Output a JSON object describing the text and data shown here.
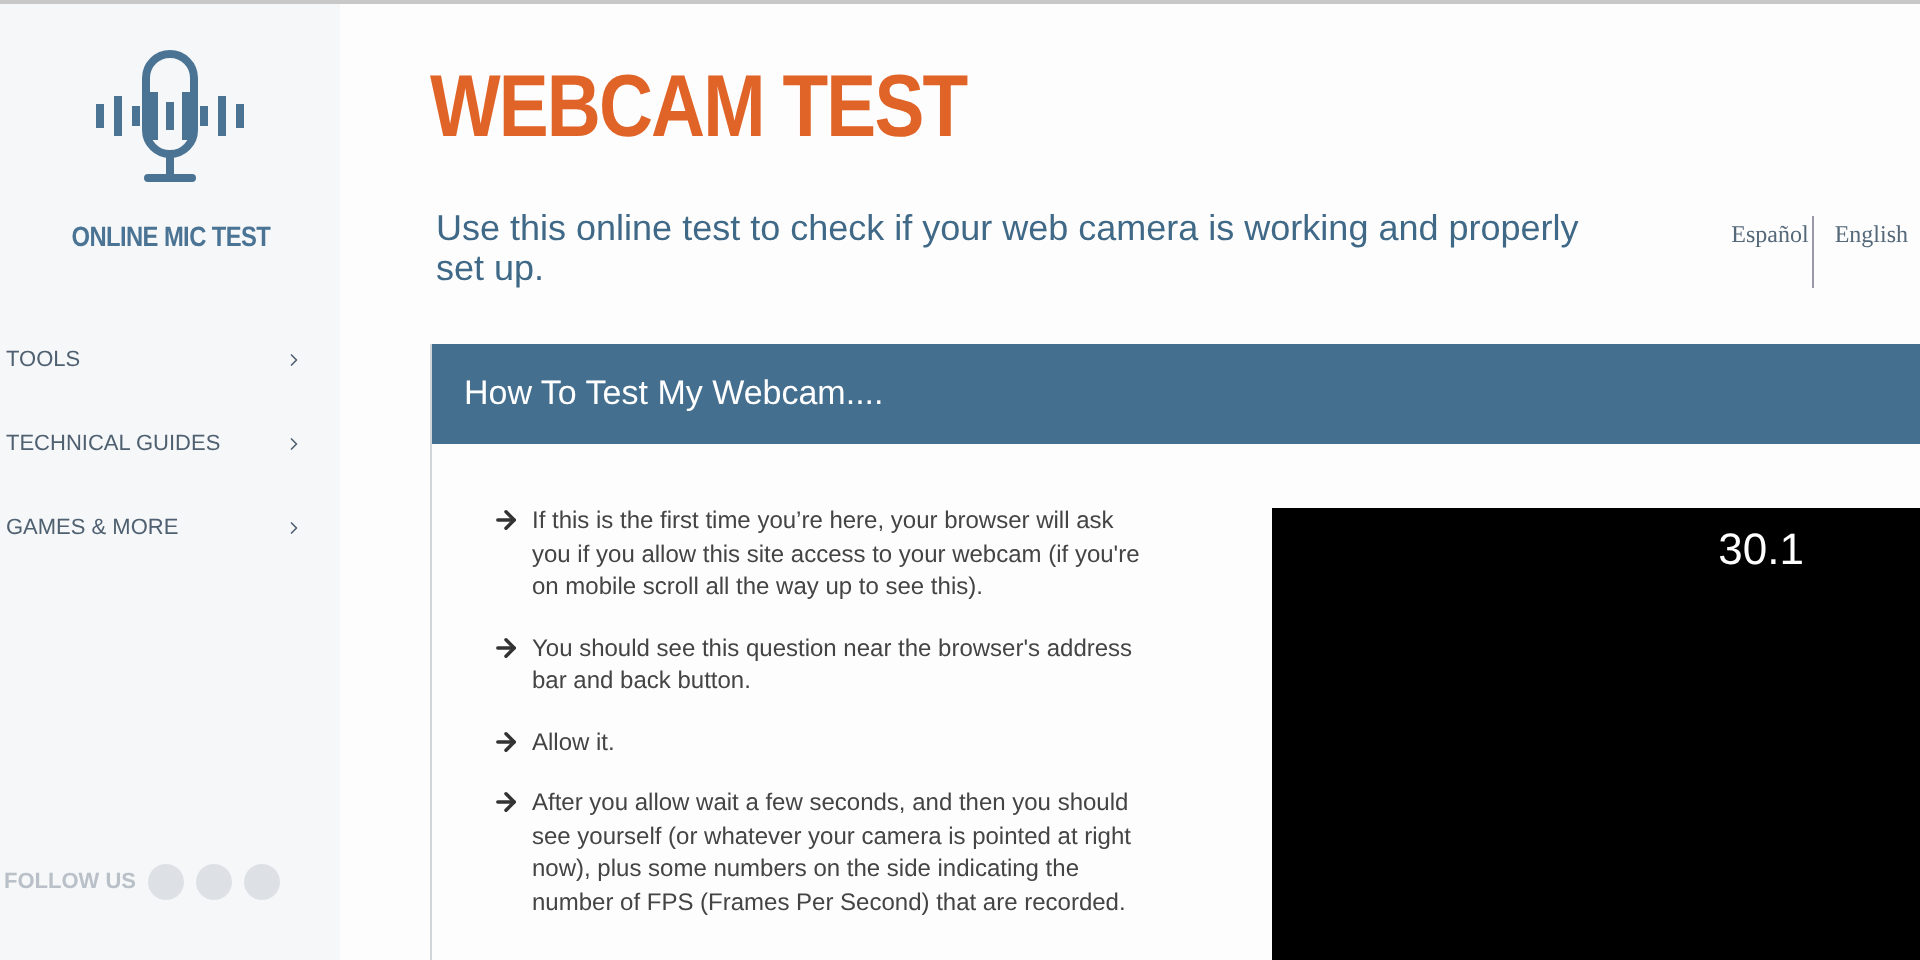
{
  "logo": {
    "text": "ONLINE MIC TEST"
  },
  "nav": [
    {
      "label": "TOOLS"
    },
    {
      "label": "TECHNICAL GUIDES"
    },
    {
      "label": "GAMES & MORE"
    }
  ],
  "follow": {
    "label": "FOLLOW US"
  },
  "title": "WEBCAM TEST",
  "subtitle": "Use this online test to check if your web camera is working and properly set up.",
  "languages": [
    "Español",
    "English"
  ],
  "panel": {
    "heading": "How To Test My Webcam....",
    "steps": [
      "If this is the first time you’re here, your browser will ask you if you allow this site access to your webcam (if you're on mobile scroll all the way up to see this).",
      "You should see this question near the browser's address bar and back button.",
      "Allow it.",
      "After you allow wait a few seconds, and then you should see yourself (or whatever your camera is pointed at right now), plus some numbers on the side indicating the number of FPS (Frames Per Second) that are recorded."
    ],
    "fps": "30.1"
  }
}
